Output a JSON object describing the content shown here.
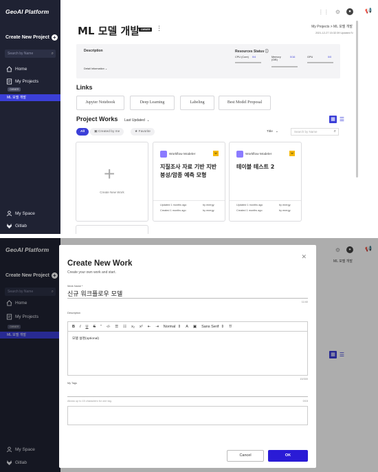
{
  "colors": {
    "sidebar": "#1f2233",
    "accent": "#3b3fd8",
    "ok_button": "#2a1bd6",
    "tag_yellow": "#f5b800"
  },
  "sidebar": {
    "logo": "GeoAI Platform",
    "create_label": "Create New Project",
    "search_placeholder": "Search by Name",
    "items": {
      "home": "Home",
      "my_projects": "My Projects",
      "owner_badge": "OWNER",
      "active_project": "ML 모델 개발",
      "my_space": "My Space",
      "gitlab": "Gitlab"
    }
  },
  "header": {
    "title": "ML 모델 개발",
    "owner_badge": "OWNER",
    "breadcrumb": "My Projects > ML 모델 개발",
    "updated": "2021-12-27 15:32:39 Updated"
  },
  "info": {
    "description_label": "Description",
    "detail_label": "Detail Information",
    "resources_label": "Resources Status",
    "cpu_label": "CPU (Core)",
    "cpu_value": "0/4",
    "memory_label": "Memory (GiB)",
    "memory_value": "0/16",
    "gpu_label": "GPU",
    "gpu_value": "0/0"
  },
  "links": {
    "title": "Links",
    "items": [
      "Jupyter Notebook",
      "Deep Learning",
      "Labeling",
      "Best Model Proposal"
    ]
  },
  "works": {
    "title": "Project Works",
    "sort": "Last Updated",
    "filters": {
      "all": "All",
      "created": "Created by me",
      "favorite": "Favorite"
    },
    "title_select": "Title",
    "search_placeholder": "Search by Name",
    "create_label": "Create New Work",
    "cards": [
      {
        "type": "Workflow Modeler",
        "tag": "W",
        "title": "지질조사 자료 기반 지반붕성/암종 예측 모형",
        "updated": "Updated 1 months ago",
        "created": "Created 1 months ago",
        "by1": "by energy",
        "by2": "by energy"
      },
      {
        "type": "Workflow Modeler",
        "tag": "W",
        "title": "테이블 테스트 2",
        "updated": "Updated 1 months ago",
        "created": "Created 1 months ago",
        "by1": "by energy",
        "by2": "by energy"
      }
    ]
  },
  "modal": {
    "title": "Create New Work",
    "subtitle": "Create your own work and start.",
    "name_label": "Work Name *",
    "name_value": "신규 워크플로우 모델",
    "name_count": "11/40",
    "desc_label": "Description",
    "toolbar": {
      "format": "Normal",
      "font": "Sans Serif"
    },
    "desc_value": "모델 설명(optional)",
    "desc_count": "15/300",
    "tags_label": "My Tags",
    "tags_hint": "Allows up to 15 characters for one tag.",
    "tags_count": "0/15",
    "cancel": "Cancel",
    "ok": "OK"
  }
}
